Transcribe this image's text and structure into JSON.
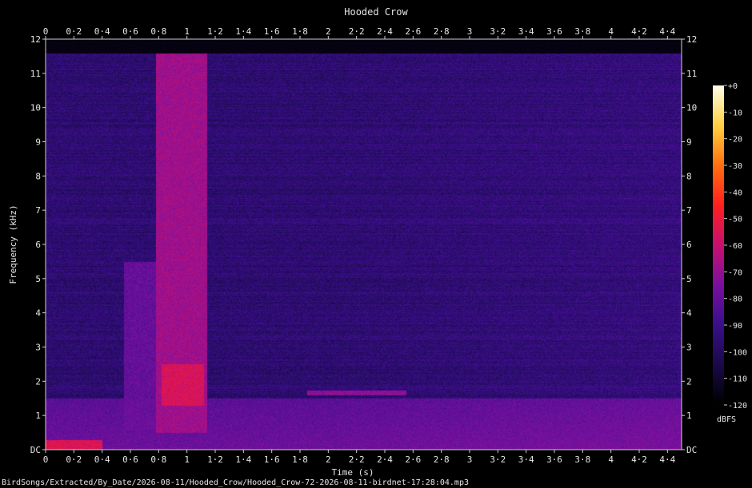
{
  "chart_data": {
    "type": "heatmap",
    "title": "Hooded Crow",
    "xlabel": "Time (s)",
    "ylabel": "Frequency (kHz)",
    "xlim": [
      0,
      4.5
    ],
    "ylim": [
      0,
      12
    ],
    "x_ticks": [
      "0",
      "0·2",
      "0·4",
      "0·6",
      "0·8",
      "1",
      "1·2",
      "1·4",
      "1·6",
      "1·8",
      "2",
      "2·2",
      "2·4",
      "2·6",
      "2·8",
      "3",
      "3·2",
      "3·4",
      "3·6",
      "3·8",
      "4",
      "4·2",
      "4·4"
    ],
    "x_tick_values": [
      0,
      0.2,
      0.4,
      0.6,
      0.8,
      1.0,
      1.2,
      1.4,
      1.6,
      1.8,
      2.0,
      2.2,
      2.4,
      2.6,
      2.8,
      3.0,
      3.2,
      3.4,
      3.6,
      3.8,
      4.0,
      4.2,
      4.4
    ],
    "y_ticks": [
      "DC",
      "1",
      "2",
      "3",
      "4",
      "5",
      "6",
      "7",
      "8",
      "9",
      "10",
      "11",
      "12"
    ],
    "y_tick_values": [
      0,
      1,
      2,
      3,
      4,
      5,
      6,
      7,
      8,
      9,
      10,
      11,
      12
    ],
    "colorbar": {
      "label": "dBFS",
      "range": [
        -120,
        0
      ],
      "ticks": [
        "+0",
        "-10",
        "-20",
        "-30",
        "-40",
        "-50",
        "-60",
        "-70",
        "-80",
        "-90",
        "-100",
        "-110",
        "-120"
      ],
      "tick_values": [
        0,
        -10,
        -20,
        -30,
        -40,
        -50,
        -60,
        -70,
        -80,
        -90,
        -100,
        -110,
        -120
      ],
      "colormap": [
        "#000000",
        "#1a0a4a",
        "#3a0f8a",
        "#7a10a0",
        "#c81070",
        "#ff2020",
        "#ff7010",
        "#ffd040",
        "#ffffe8"
      ]
    },
    "events": [
      {
        "t_start": 0.78,
        "t_end": 1.14,
        "f_low": 0.5,
        "f_high": 11.6,
        "level_db": -68
      },
      {
        "t_start": 0.82,
        "t_end": 1.12,
        "f_low": 1.3,
        "f_high": 2.5,
        "level_db": -56
      },
      {
        "t_start": 0.55,
        "t_end": 0.78,
        "f_low": 0.6,
        "f_high": 5.5,
        "level_db": -80
      },
      {
        "t_start": 1.85,
        "t_end": 2.55,
        "f_low": 1.6,
        "f_high": 1.75,
        "level_db": -72
      },
      {
        "t_start": 0.0,
        "t_end": 0.4,
        "f_low": 0.0,
        "f_high": 0.3,
        "level_db": -55
      }
    ],
    "noise_floor_db": -96,
    "noise_ceiling_khz": 11.6,
    "low_band_db": -78
  },
  "footer": {
    "file_path": "BirdSongs/Extracted/By_Date/2026-08-11/Hooded_Crow/Hooded_Crow-72-2026-08-11-birdnet-17:28:04.mp3"
  }
}
